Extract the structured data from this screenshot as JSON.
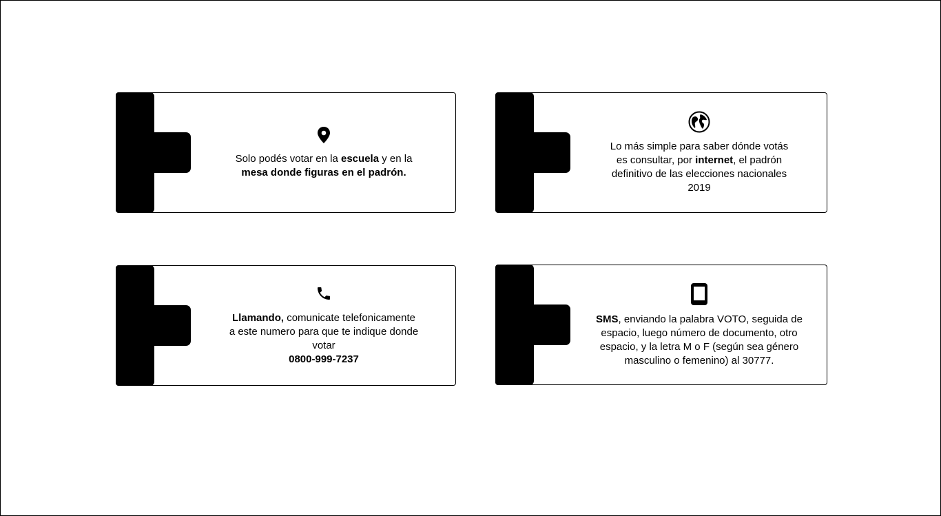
{
  "cards": [
    {
      "icon": "map-pin-icon",
      "parts": [
        {
          "t": "Solo podés votar en la ",
          "b": false
        },
        {
          "t": "escuela",
          "b": true
        },
        {
          "t": " y en la",
          "b": false
        }
      ],
      "line2": "mesa donde figuras en el padrón."
    },
    {
      "icon": "globe-icon",
      "line1": "Lo más simple para saber dónde votás",
      "line2_a": "es consultar, por ",
      "line2_b": "internet",
      "line2_c": ", el padrón",
      "line3": "definitivo de las elecciones nacionales",
      "line4": "2019"
    },
    {
      "icon": "phone-icon",
      "line1_a": "Llamando,",
      "line1_b": " comunicate telefonicamente",
      "line2": "a este numero para que te indique donde",
      "line3": "votar",
      "phone": "0800-999-7237"
    },
    {
      "icon": "tablet-icon",
      "line1_a": "SMS",
      "line1_b": ", enviando la palabra VOTO, seguida de",
      "line2": "espacio, luego número de documento, otro",
      "line3": "espacio, y la letra M o F (según sea género",
      "line4": "masculino o femenino) al 30777."
    }
  ]
}
